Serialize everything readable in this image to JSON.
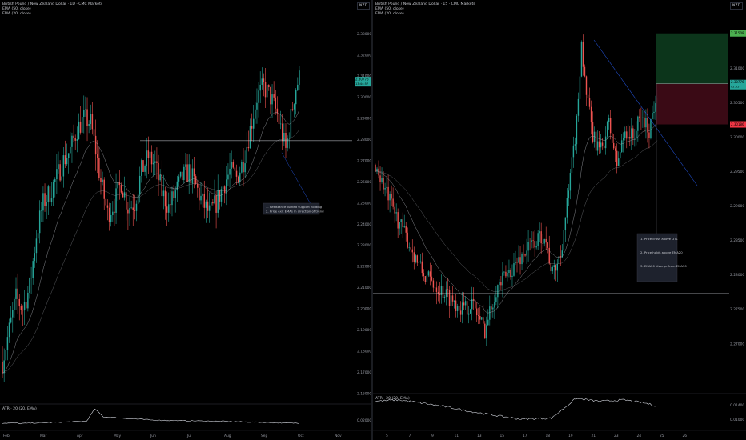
{
  "left": {
    "title": "British Pound / New Zealand Dollar · 1D · CMC Markets",
    "indicators": [
      "EMA (50, close)",
      "EMA (20, close)"
    ],
    "currency": "NZD",
    "price_label": "2.30776",
    "price_label_small": "13:44:57",
    "annotation": [
      "1. Resistance turned support holding",
      "2. Price exit EMAs in direction of trend"
    ],
    "atr_title": "ATR · 20 (20, EMA)",
    "atr_value_label": "0.02000"
  },
  "right": {
    "title": "British Pound / New Zealand Dollar · 15 · CMC Markets",
    "indicators": [
      "EMA (50, close)",
      "EMA (20, close)"
    ],
    "currency": "NZD",
    "tp_label": "2.31508",
    "entry_label": "2.30776",
    "entry_label_small": "02:55",
    "sl_label": "2.30186",
    "annotation": [
      "1. Price cross above DTL",
      "",
      "2. Price holds above EMA20",
      "",
      "3. EMA20 diverge from EMA50"
    ],
    "atr_title": "ATR · 20 (20, EMA)",
    "atr_value_1": "0.01400",
    "atr_value_2": "0.01000"
  },
  "chart_data": [
    {
      "type": "candlestick",
      "title": "British Pound / New Zealand Dollar · 1D · CMC Markets",
      "x_ticks": [
        "Feb",
        "Mar",
        "Apr",
        "May",
        "Jun",
        "Jul",
        "Aug",
        "Sep",
        "Oct",
        "Nov"
      ],
      "y_ticks": [
        2.33,
        2.32,
        2.31,
        2.3,
        2.29,
        2.28,
        2.27,
        2.26,
        2.25,
        2.24,
        2.23,
        2.22,
        2.21,
        2.2,
        2.19,
        2.18,
        2.17,
        2.16
      ],
      "y_tick_labels": [
        "2.33000",
        "2.32000",
        "2.31000",
        "2.30000",
        "2.29000",
        "2.28000",
        "2.27000",
        "2.26000",
        "2.25000",
        "2.24000",
        "2.23000",
        "2.22000",
        "2.21000",
        "2.20000",
        "2.19000",
        "2.18000",
        "2.17000",
        "2.16000"
      ],
      "ylim": [
        2.155,
        2.343
      ],
      "last_price": 2.30776,
      "support_level": 2.2795,
      "series_shape": [
        [
          0,
          2.175
        ],
        [
          4,
          2.19
        ],
        [
          8,
          2.205
        ],
        [
          12,
          2.2
        ],
        [
          16,
          2.21
        ],
        [
          20,
          2.235
        ],
        [
          24,
          2.25
        ],
        [
          28,
          2.255
        ],
        [
          32,
          2.262
        ],
        [
          36,
          2.27
        ],
        [
          40,
          2.275
        ],
        [
          44,
          2.285
        ],
        [
          48,
          2.29
        ],
        [
          52,
          2.288
        ],
        [
          55,
          2.275
        ],
        [
          58,
          2.26
        ],
        [
          62,
          2.245
        ],
        [
          66,
          2.25
        ],
        [
          70,
          2.26
        ],
        [
          74,
          2.248
        ],
        [
          78,
          2.25
        ],
        [
          82,
          2.265
        ],
        [
          86,
          2.272
        ],
        [
          90,
          2.268
        ],
        [
          94,
          2.255
        ],
        [
          98,
          2.248
        ],
        [
          102,
          2.255
        ],
        [
          106,
          2.262
        ],
        [
          110,
          2.265
        ],
        [
          114,
          2.258
        ],
        [
          118,
          2.25
        ],
        [
          122,
          2.245
        ],
        [
          126,
          2.25
        ],
        [
          130,
          2.258
        ],
        [
          134,
          2.265
        ],
        [
          138,
          2.262
        ],
        [
          142,
          2.27
        ],
        [
          146,
          2.285
        ],
        [
          150,
          2.3
        ],
        [
          154,
          2.305
        ],
        [
          158,
          2.3
        ],
        [
          162,
          2.292
        ],
        [
          165,
          2.282
        ],
        [
          167,
          2.275
        ],
        [
          169,
          2.285
        ],
        [
          171,
          2.296
        ],
        [
          173,
          2.305
        ],
        [
          175,
          2.309
        ]
      ],
      "atr": {
        "title": "ATR · 20 (20, EMA)",
        "value": 0.02,
        "tick": "0.02000",
        "shape": [
          [
            10,
            0.018
          ],
          [
            50,
            0.019
          ],
          [
            55,
            0.0245
          ],
          [
            60,
            0.021
          ],
          [
            90,
            0.0195
          ],
          [
            130,
            0.019
          ],
          [
            170,
            0.0182
          ]
        ]
      }
    },
    {
      "type": "candlestick",
      "title": "British Pound / New Zealand Dollar · 15 · CMC Markets",
      "x_ticks": [
        "5",
        "7",
        "9",
        "11",
        "13",
        "15",
        "17",
        "18",
        "19",
        "21",
        "23",
        "24",
        "25",
        "26"
      ],
      "y_ticks": [
        2.31,
        2.305,
        2.3,
        2.295,
        2.29,
        2.285,
        2.28,
        2.275,
        2.27
      ],
      "y_tick_labels": [
        "2.31000",
        "2.30500",
        "2.30000",
        "2.29500",
        "2.29000",
        "2.28500",
        "2.28000",
        "2.27500",
        "2.27000"
      ],
      "ylim": [
        2.263,
        2.319
      ],
      "entry": 2.30776,
      "take_profit": 2.31508,
      "stop_loss": 2.30186,
      "support_level": 2.2773,
      "series_shape": [
        [
          0,
          2.296
        ],
        [
          10,
          2.29
        ],
        [
          20,
          2.285
        ],
        [
          30,
          2.28
        ],
        [
          35,
          2.279
        ],
        [
          45,
          2.277
        ],
        [
          55,
          2.275
        ],
        [
          60,
          2.276
        ],
        [
          68,
          2.272
        ],
        [
          75,
          2.278
        ],
        [
          85,
          2.281
        ],
        [
          95,
          2.284
        ],
        [
          105,
          2.286
        ],
        [
          110,
          2.28
        ],
        [
          115,
          2.283
        ],
        [
          120,
          2.292
        ],
        [
          125,
          2.302
        ],
        [
          128,
          2.314
        ],
        [
          130,
          2.308
        ],
        [
          135,
          2.3
        ],
        [
          140,
          2.298
        ],
        [
          145,
          2.302
        ],
        [
          150,
          2.296
        ],
        [
          155,
          2.301
        ],
        [
          160,
          2.3
        ],
        [
          165,
          2.303
        ],
        [
          170,
          2.301
        ],
        [
          175,
          2.307
        ]
      ],
      "atr": {
        "title": "ATR · 20 (20, EMA)",
        "ticks": [
          "0.01400",
          "0.01000"
        ],
        "shape": [
          [
            0,
            0.0142
          ],
          [
            15,
            0.0145
          ],
          [
            30,
            0.0138
          ],
          [
            45,
            0.013
          ],
          [
            60,
            0.012
          ],
          [
            75,
            0.0112
          ],
          [
            90,
            0.0104
          ],
          [
            110,
            0.0106
          ],
          [
            125,
            0.0148
          ],
          [
            140,
            0.0142
          ],
          [
            155,
            0.0145
          ],
          [
            168,
            0.0138
          ],
          [
            175,
            0.0132
          ]
        ]
      }
    }
  ],
  "colors": {
    "background": "#000000",
    "bull": "#26a69a",
    "bear": "#ef5350",
    "ema_line": "#a3a6ad",
    "long_tp_zone": "#0d3b1e",
    "long_sl_zone": "#3d0b16",
    "tp_label": "#4caf50",
    "sl_label": "#f23645",
    "annotation_bg": "#1e222d"
  }
}
